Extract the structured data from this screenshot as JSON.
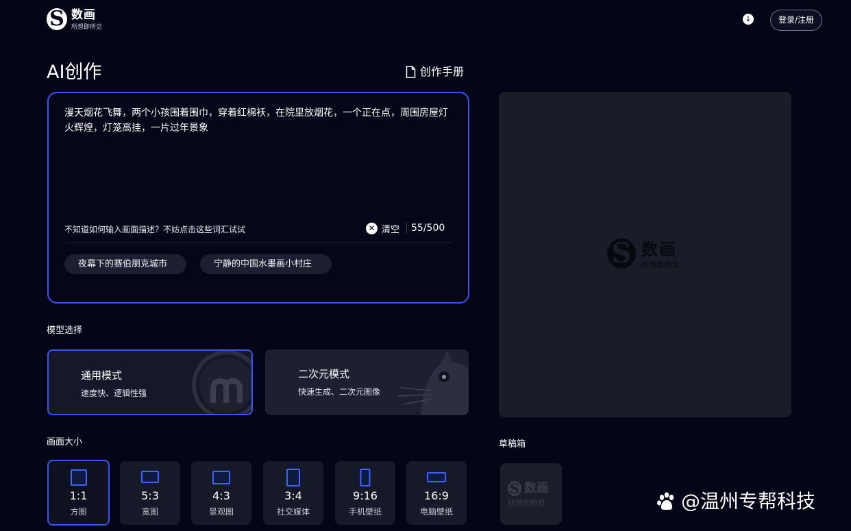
{
  "header": {
    "logo": {
      "name": "数画",
      "slogan": "所想即所见",
      "letter": "S"
    },
    "download_icon": "download-icon",
    "login_label": "登录/注册"
  },
  "page": {
    "title": "AI创作",
    "manual_label": "创作手册",
    "manual_icon": "document-icon"
  },
  "prompt": {
    "text": "漫天烟花飞舞，两个小孩围着围巾，穿着红棉袄，在院里放烟花，一个正在点，周围房屋灯火辉煌，灯笼高挂，一片过年景象",
    "hint": "不知道如何输入画面描述？不妨点击这些词汇试试",
    "clear_label": "清空",
    "counter": "55/500",
    "suggestions": [
      "夜幕下的赛伯朋克城市",
      "宁静的中国水墨画小村庄"
    ]
  },
  "model_section": {
    "label": "模型选择",
    "models": [
      {
        "title": "通用模式",
        "subtitle": "速度快、逻辑性强",
        "selected": true
      },
      {
        "title": "二次元模式",
        "subtitle": "快速生成、二次元图像",
        "selected": false
      }
    ]
  },
  "size_section": {
    "label": "画面大小",
    "sizes": [
      {
        "ratio": "1:1",
        "label": "方图",
        "selected": true
      },
      {
        "ratio": "5:3",
        "label": "宽图",
        "selected": false
      },
      {
        "ratio": "4:3",
        "label": "景观图",
        "selected": false
      },
      {
        "ratio": "3:4",
        "label": "社交媒体",
        "selected": false
      },
      {
        "ratio": "9:16",
        "label": "手机壁纸",
        "selected": false
      },
      {
        "ratio": "16:9",
        "label": "电脑壁纸",
        "selected": false
      }
    ]
  },
  "preview": {
    "logo_name": "数画",
    "logo_slogan": "所想即所见",
    "logo_letter": "S"
  },
  "drafts": {
    "label": "草稿箱",
    "logo_name": "数画",
    "logo_slogan": "所想即所见",
    "logo_letter": "S"
  },
  "watermark": {
    "text": "@温州专帮科技",
    "icon": "baidu-paw-icon"
  },
  "colors": {
    "accent": "#3657f0",
    "background": "#040617",
    "panel": "#1a1c27"
  }
}
